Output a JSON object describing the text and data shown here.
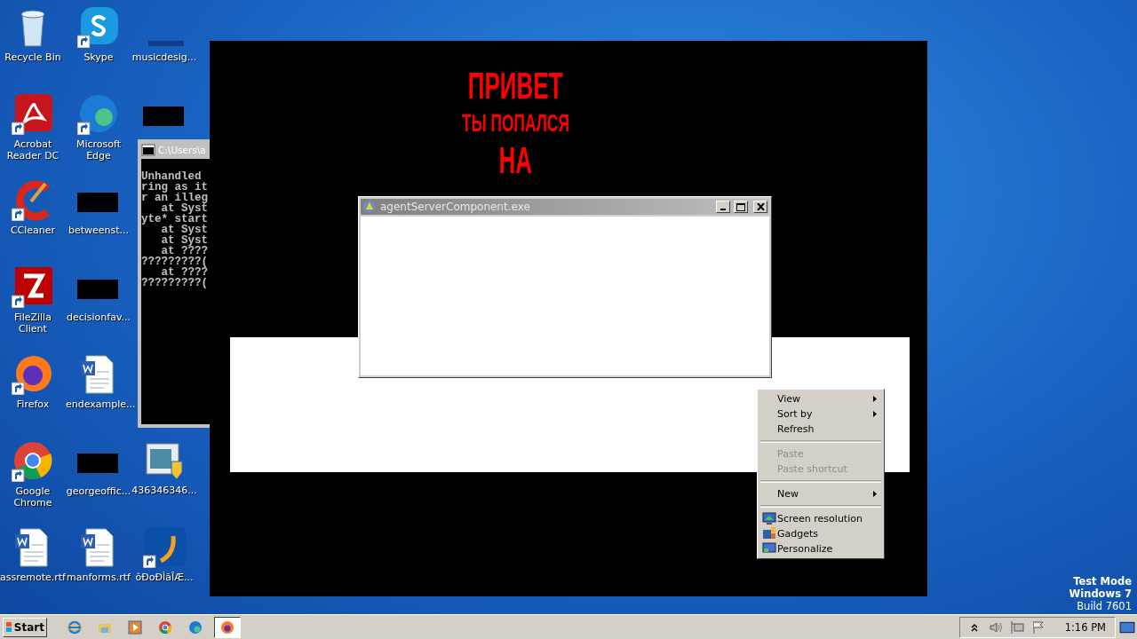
{
  "icon_columns": [
    {
      "icons": [
        {
          "label": "Recycle Bin",
          "kind": "recycle",
          "shortcut": false
        },
        {
          "label": "Acrobat Reader DC",
          "kind": "acrobat",
          "shortcut": true
        },
        {
          "label": "CCleaner",
          "kind": "ccleaner",
          "shortcut": true
        },
        {
          "label": "FileZilla Client",
          "kind": "filezilla",
          "shortcut": true
        },
        {
          "label": "Firefox",
          "kind": "firefox",
          "shortcut": true
        },
        {
          "label": "Google Chrome",
          "kind": "chrome",
          "shortcut": true
        },
        {
          "label": "assremote.rtf",
          "kind": "word",
          "shortcut": false
        }
      ]
    },
    {
      "icons": [
        {
          "label": "Skype",
          "kind": "skype",
          "shortcut": true
        },
        {
          "label": "Microsoft Edge",
          "kind": "edge",
          "shortcut": true
        },
        {
          "label": "betweenst...",
          "kind": "redacted",
          "shortcut": false
        },
        {
          "label": "decisionfav...",
          "kind": "redacted",
          "shortcut": false
        },
        {
          "label": "endexample...",
          "kind": "word",
          "shortcut": false
        },
        {
          "label": "georgeoffic...",
          "kind": "redacted",
          "shortcut": false
        },
        {
          "label": "manforms.rtf",
          "kind": "word",
          "shortcut": false
        }
      ]
    },
    {
      "icons": [
        {
          "label": "musicdesig...",
          "kind": "strip",
          "shortcut": false
        },
        {
          "kind": "redacted",
          "shortcut": false
        }
      ],
      "bottom_icons": [
        {
          "label": "436346346...",
          "kind": "installer",
          "shortcut": false
        },
        {
          "label": "ôÐoÐÌãÎÆ...",
          "kind": "updater",
          "shortcut": true
        }
      ]
    }
  ],
  "console": {
    "title": "C:\\Users\\a",
    "lines": [
      "Unhandled",
      "ring as it",
      "r an illeg",
      "   at Syst",
      "yte* start",
      "   at Syst",
      "   at Syst",
      "   at ????",
      "?????????(",
      "   at ????",
      "?????????("
    ]
  },
  "lock_screen": {
    "lines": [
      {
        "text": "ПРИВЕТ",
        "kind": "big"
      },
      {
        "text": "ТЫ ПОПАЛСЯ",
        "kind": "small"
      },
      {
        "text": "НА",
        "kind": "big"
      }
    ]
  },
  "dialog": {
    "title": "agentServerComponent.exe"
  },
  "context_menu": [
    {
      "kind": "item",
      "label": "View",
      "submenu": true,
      "disabled": false
    },
    {
      "kind": "item",
      "label": "Sort by",
      "submenu": true,
      "disabled": false
    },
    {
      "kind": "item",
      "label": "Refresh",
      "submenu": false,
      "disabled": false
    },
    {
      "kind": "separator"
    },
    {
      "kind": "item",
      "label": "Paste",
      "submenu": false,
      "disabled": true
    },
    {
      "kind": "item",
      "label": "Paste shortcut",
      "submenu": false,
      "disabled": true
    },
    {
      "kind": "separator"
    },
    {
      "kind": "item",
      "label": "New",
      "submenu": true,
      "disabled": false
    },
    {
      "kind": "separator"
    },
    {
      "kind": "monitor",
      "label": "Screen resolution",
      "submenu": false,
      "disabled": false
    },
    {
      "kind": "gadgets",
      "label": "Gadgets",
      "submenu": false,
      "disabled": false
    },
    {
      "kind": "personalize",
      "label": "Personalize",
      "submenu": false,
      "disabled": false
    }
  ],
  "os_notice": [
    "Test Mode",
    "Windows 7",
    "Build 7601"
  ],
  "taskbar": {
    "start": "Start",
    "apps": [
      {
        "kind": "ie",
        "selected": false
      },
      {
        "kind": "explorer",
        "selected": false
      },
      {
        "kind": "media",
        "selected": false
      },
      {
        "kind": "chrome",
        "selected": false
      },
      {
        "kind": "edge",
        "selected": false
      },
      {
        "kind": "firefox",
        "selected": true
      }
    ],
    "clock": "1:16 PM"
  }
}
